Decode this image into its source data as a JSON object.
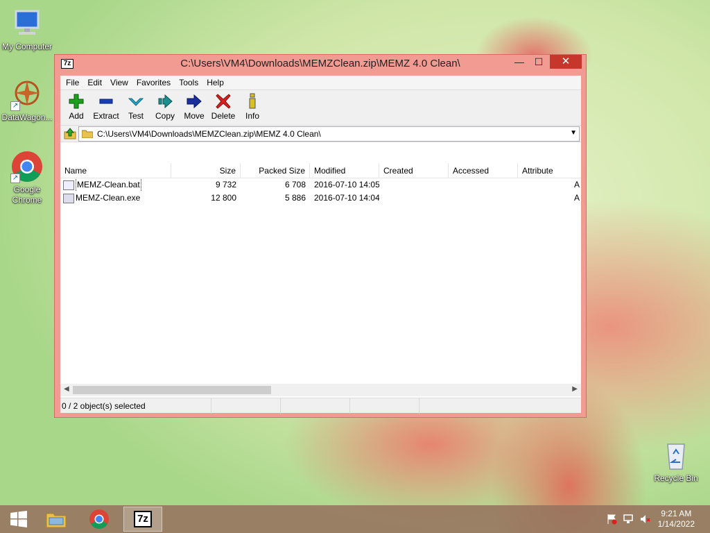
{
  "desktop": {
    "icons": [
      {
        "label": "My Computer"
      },
      {
        "label": "DataWagon..."
      },
      {
        "label": "Google Chrome"
      },
      {
        "label": "Recycle Bin"
      }
    ]
  },
  "window": {
    "app_icon_text": "7z",
    "title": "C:\\Users\\VM4\\Downloads\\MEMZClean.zip\\MEMZ 4.0 Clean\\",
    "buttons": {
      "minimize": "—",
      "maximize": "☐",
      "close": "✕"
    }
  },
  "menu": [
    "File",
    "Edit",
    "View",
    "Favorites",
    "Tools",
    "Help"
  ],
  "toolbar": [
    {
      "label": "Add",
      "icon": "plus-icon",
      "color": "#1e9e1e"
    },
    {
      "label": "Extract",
      "icon": "minus-icon",
      "color": "#1a3fb4"
    },
    {
      "label": "Test",
      "icon": "check-icon",
      "color": "#2aa8c8"
    },
    {
      "label": "Copy",
      "icon": "copy-arrow-icon",
      "color": "#1e8f8f"
    },
    {
      "label": "Move",
      "icon": "move-arrow-icon",
      "color": "#1a2f9c"
    },
    {
      "label": "Delete",
      "icon": "delete-x-icon",
      "color": "#d82020"
    },
    {
      "label": "Info",
      "icon": "info-icon",
      "color": "#d8c020"
    }
  ],
  "address": {
    "path": "C:\\Users\\VM4\\Downloads\\MEMZClean.zip\\MEMZ 4.0 Clean\\"
  },
  "columns": [
    "Name",
    "Size",
    "Packed Size",
    "Modified",
    "Created",
    "Accessed",
    "Attribute"
  ],
  "files": [
    {
      "name": "MEMZ-Clean.bat",
      "size": "9 732",
      "packed": "6 708",
      "modified": "2016-07-10 14:05",
      "created": "",
      "accessed": "",
      "attr": "A"
    },
    {
      "name": "MEMZ-Clean.exe",
      "size": "12 800",
      "packed": "5 886",
      "modified": "2016-07-10 14:04",
      "created": "",
      "accessed": "",
      "attr": "A"
    }
  ],
  "status": {
    "selection": "0 / 2 object(s) selected"
  },
  "taskbar": {
    "time": "9:21 AM",
    "date": "1/14/2022",
    "active_app_text": "7z"
  },
  "colors": {
    "window_frame": "#f19b93",
    "close_button": "#c7362a"
  }
}
